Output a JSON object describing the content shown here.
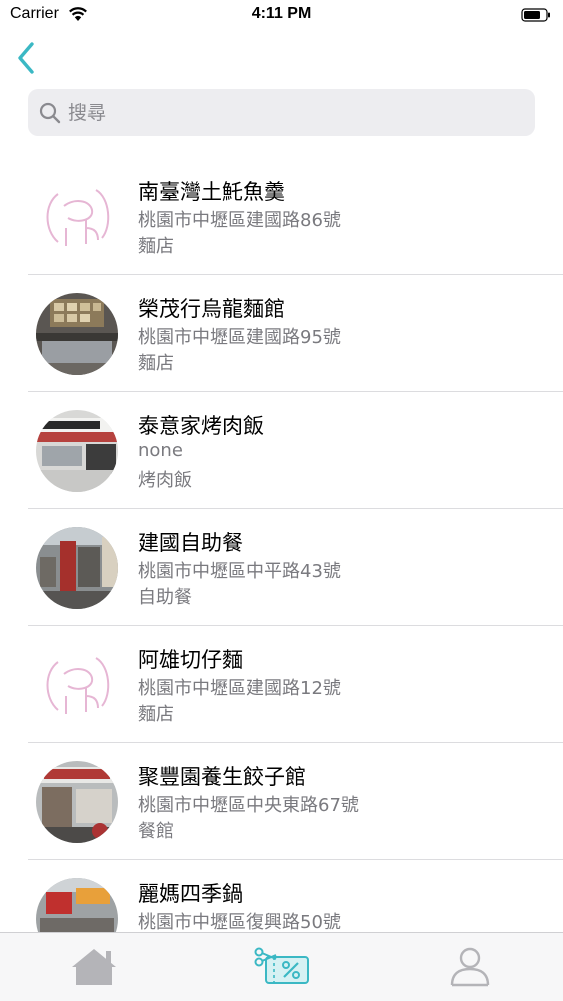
{
  "status_bar": {
    "carrier": "Carrier",
    "time": "4:11 PM"
  },
  "search": {
    "placeholder": "搜尋",
    "value": ""
  },
  "colors": {
    "accent": "#3bb8c4",
    "avatar_placeholder": "#e6b6d4",
    "tab_inactive": "#b4b4b8"
  },
  "restaurants": [
    {
      "name": "南臺灣土魠魚羹",
      "address": "桃園市中壢區建國路86號",
      "category": "麵店",
      "avatar": "placeholder"
    },
    {
      "name": "榮茂行烏龍麵館",
      "address": "桃園市中壢區建國路95號",
      "category": "麵店",
      "avatar": "photo"
    },
    {
      "name": "泰意家烤肉飯",
      "address": "none",
      "category": "烤肉飯",
      "avatar": "photo"
    },
    {
      "name": "建國自助餐",
      "address": "桃園市中壢區中平路43號",
      "category": "自助餐",
      "avatar": "photo"
    },
    {
      "name": "阿雄切仔麵",
      "address": "桃園市中壢區建國路12號",
      "category": "麵店",
      "avatar": "placeholder"
    },
    {
      "name": "聚豐園養生餃子館",
      "address": "桃園市中壢區中央東路67號",
      "category": "餐館",
      "avatar": "photo"
    },
    {
      "name": "麗媽四季鍋",
      "address": "桃園市中壢區復興路50號",
      "category": "",
      "avatar": "photo"
    }
  ],
  "tab_bar": {
    "tabs": [
      {
        "icon": "home-icon",
        "active": false
      },
      {
        "icon": "coupon-icon",
        "active": true
      },
      {
        "icon": "profile-icon",
        "active": false
      }
    ]
  }
}
